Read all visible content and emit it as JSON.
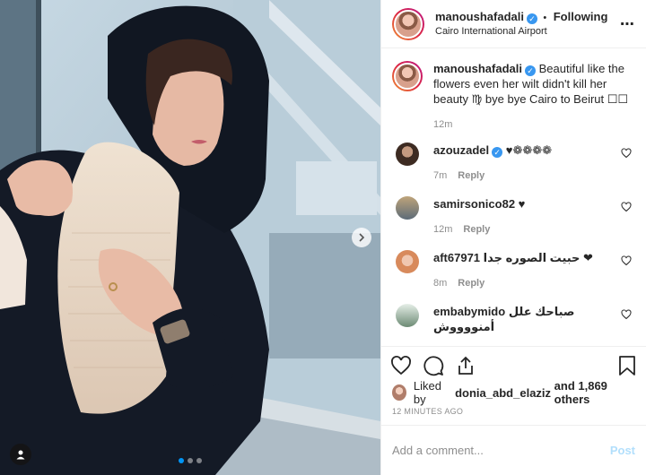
{
  "post": {
    "username": "manoushafadali",
    "separator": "•",
    "following_label": "Following",
    "location": "Cairo International Airport",
    "verified_icon": "verified-badge-icon"
  },
  "caption": {
    "username": "manoushafadali",
    "text": "Beautiful like the flowers even her wilt didn't kill her beauty ♍ bye bye Cairo to Beirut ☐☐",
    "time": "12m"
  },
  "comments": [
    {
      "username": "azouzadel",
      "verified": true,
      "text": "♥❁❁❁❁",
      "time": "7m",
      "reply_label": "Reply"
    },
    {
      "username": "samirsonico82",
      "verified": false,
      "text": "♥",
      "time": "12m",
      "reply_label": "Reply"
    },
    {
      "username": "aft67971",
      "verified": false,
      "text": "حبيت الصوره جدا ❤",
      "time": "8m",
      "reply_label": "Reply"
    },
    {
      "username": "embabymido",
      "verified": false,
      "text": "صباحك علل أمنووووش",
      "time": "",
      "reply_label": ""
    }
  ],
  "likes": {
    "prefix": "Liked by",
    "user": "donia_abd_elaziz",
    "suffix": "and 1,869 others"
  },
  "time_ago": "12 MINUTES AGO",
  "composer": {
    "placeholder": "Add a comment...",
    "post_label": "Post"
  },
  "colors": {
    "verified": "#3897f0",
    "active_dot": "#0095f6",
    "post_button_disabled": "#b2dffc"
  },
  "icons": [
    "heart-icon",
    "comment-icon",
    "share-icon",
    "bookmark-icon",
    "more-options-icon",
    "chevron-right-icon",
    "user-tag-icon"
  ]
}
